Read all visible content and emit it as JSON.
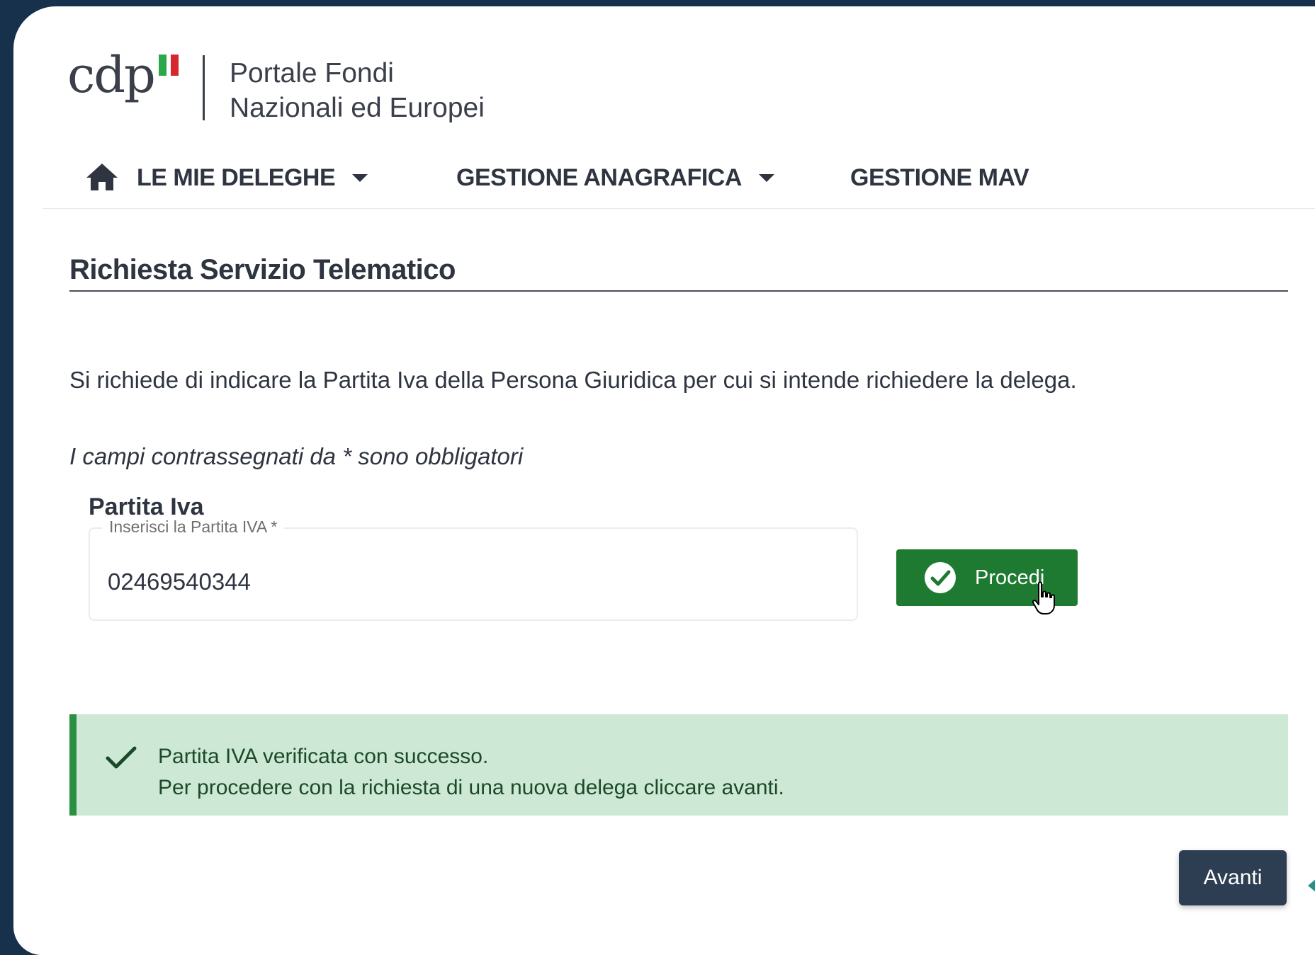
{
  "header": {
    "logo_text": "cdp",
    "portal_line1": "Portale Fondi",
    "portal_line2": "Nazionali ed Europei"
  },
  "nav": {
    "home_icon": "home-icon",
    "items": [
      {
        "label": "LE MIE DELEGHE",
        "dropdown": true
      },
      {
        "label": "GESTIONE ANAGRAFICA",
        "dropdown": true
      },
      {
        "label": "GESTIONE MAV",
        "dropdown": false
      }
    ]
  },
  "page": {
    "title": "Richiesta Servizio Telematico",
    "description": "Si richiede di indicare la Partita Iva della Persona Giuridica per cui si intende richiedere la delega.",
    "required_note": "I campi contrassegnati da * sono obbligatori"
  },
  "form": {
    "field_label": "Partita Iva",
    "field_placeholder": "Inserisci la Partita IVA *",
    "field_value": "02469540344",
    "proceed_label": "Procedi"
  },
  "alert": {
    "type": "success",
    "line1": "Partita IVA verificata con successo.",
    "line2": "Per procedere con la richiesta di una nuova delega cliccare avanti."
  },
  "footer": {
    "next_label": "Avanti"
  },
  "colors": {
    "background": "#17304b",
    "success_green": "#1f7a31",
    "alert_bg": "#cde8d5",
    "next_button": "#2e3e52"
  }
}
